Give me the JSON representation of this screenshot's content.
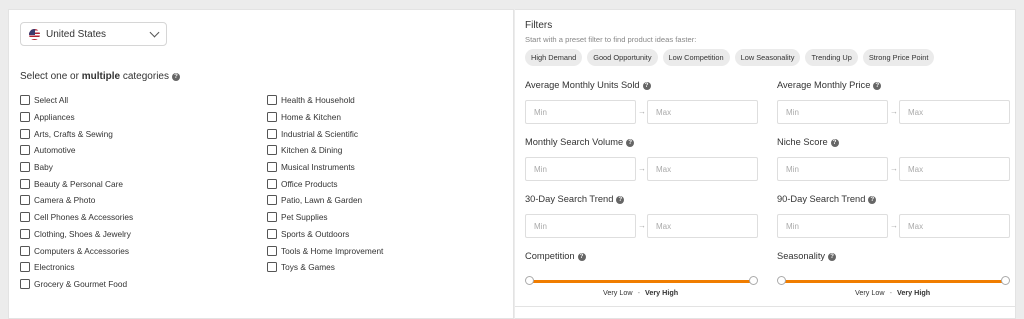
{
  "country": {
    "label": "United States",
    "icon": "us-flag-icon"
  },
  "categories": {
    "title_prefix": "Select one or",
    "title_bold": "multiple",
    "title_suffix": "categories",
    "col1": [
      "Select All",
      "Appliances",
      "Arts, Crafts & Sewing",
      "Automotive",
      "Baby",
      "Beauty & Personal Care",
      "Camera & Photo",
      "Cell Phones & Accessories",
      "Clothing, Shoes & Jewelry",
      "Computers & Accessories",
      "Electronics",
      "Grocery & Gourmet Food"
    ],
    "col2": [
      "Health & Household",
      "Home & Kitchen",
      "Industrial & Scientific",
      "Kitchen & Dining",
      "Musical Instruments",
      "Office Products",
      "Patio, Lawn & Garden",
      "Pet Supplies",
      "Sports & Outdoors",
      "Tools & Home Improvement",
      "Toys & Games"
    ]
  },
  "filters": {
    "title": "Filters",
    "subtitle": "Start with a preset filter to find product ideas faster:",
    "presets": [
      "High Demand",
      "Good Opportunity",
      "Low Competition",
      "Low Seasonality",
      "Trending Up",
      "Strong Price Point"
    ],
    "ranges": [
      {
        "label": "Average Monthly Units Sold",
        "min": "Min",
        "max": "Max"
      },
      {
        "label": "Average Monthly Price",
        "min": "Min",
        "max": "Max"
      },
      {
        "label": "Monthly Search Volume",
        "min": "Min",
        "max": "Max"
      },
      {
        "label": "Niche Score",
        "min": "Min",
        "max": "Max"
      },
      {
        "label": "30-Day Search Trend",
        "min": "Min",
        "max": "Max"
      },
      {
        "label": "90-Day Search Trend",
        "min": "Min",
        "max": "Max"
      }
    ],
    "sliders": [
      {
        "label": "Competition",
        "low": "Very Low",
        "sep": "-",
        "high": "Very High"
      },
      {
        "label": "Seasonality",
        "low": "Very Low",
        "sep": "-",
        "high": "Very High"
      }
    ],
    "arrow": "→",
    "accent_color": "#f07d00"
  }
}
